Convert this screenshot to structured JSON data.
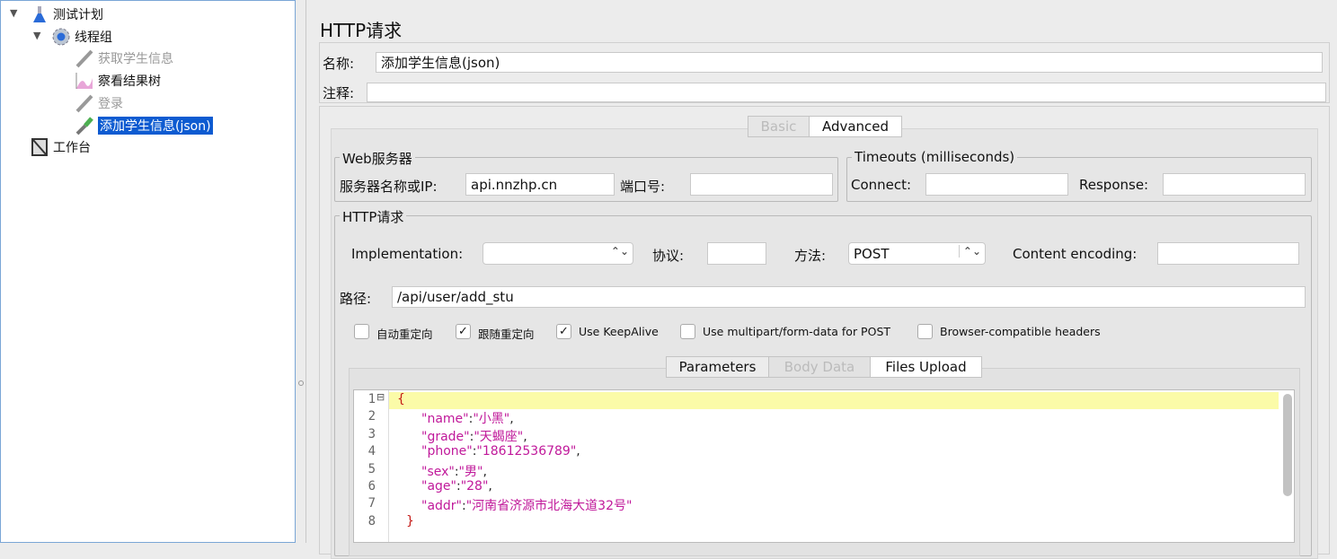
{
  "tree": {
    "items": [
      {
        "label": "测试计划",
        "icon": "test-plan-flask-icon",
        "state": "normal"
      },
      {
        "label": "线程组",
        "icon": "thread-group-gear-icon",
        "state": "normal"
      },
      {
        "label": "获取学生信息",
        "icon": "sampler-pipette-icon",
        "state": "disabled"
      },
      {
        "label": "察看结果树",
        "icon": "results-tree-chart-icon",
        "state": "normal"
      },
      {
        "label": "登录",
        "icon": "sampler-pipette-icon",
        "state": "disabled"
      },
      {
        "label": "添加学生信息(json)",
        "icon": "sampler-pipette-icon",
        "state": "selected"
      },
      {
        "label": "工作台",
        "icon": "workbench-icon",
        "state": "normal"
      }
    ]
  },
  "panel": {
    "title": "HTTP请求",
    "name_label": "名称:",
    "name_value": "添加学生信息(json)",
    "comment_label": "注释:",
    "comment_value": "",
    "tabs": [
      {
        "label": "Basic",
        "state": "disabled"
      },
      {
        "label": "Advanced",
        "state": "selected"
      }
    ],
    "web_server": {
      "legend": "Web服务器",
      "server_label": "服务器名称或IP:",
      "server_value": "api.nnzhp.cn",
      "port_label": "端口号:",
      "port_value": ""
    },
    "timeouts": {
      "legend": "Timeouts (milliseconds)",
      "connect_label": "Connect:",
      "connect_value": "",
      "response_label": "Response:",
      "response_value": ""
    },
    "http": {
      "legend": "HTTP请求",
      "impl_label": "Implementation:",
      "impl_value": "",
      "protocol_label": "协议:",
      "protocol_value": "",
      "method_label": "方法:",
      "method_value": "POST",
      "encoding_label": "Content encoding:",
      "encoding_value": "",
      "path_label": "路径:",
      "path_value": "/api/user/add_stu"
    },
    "checkboxes": [
      {
        "label": "自动重定向",
        "checked": false
      },
      {
        "label": "跟随重定向",
        "checked": true
      },
      {
        "label": "Use KeepAlive",
        "checked": true
      },
      {
        "label": "Use multipart/form-data for POST",
        "checked": false
      },
      {
        "label": "Browser-compatible headers",
        "checked": false
      }
    ],
    "subtabs": [
      {
        "label": "Parameters",
        "state": "normal"
      },
      {
        "label": "Body Data",
        "state": "disabled"
      },
      {
        "label": "Files Upload",
        "state": "normal"
      }
    ],
    "body_lines": [
      {
        "n": "1",
        "k": "",
        "v": "",
        "text": "{"
      },
      {
        "n": "2",
        "k": "\"name\"",
        "v": "\"小黑\"",
        "tail": ","
      },
      {
        "n": "3",
        "k": "\"grade\"",
        "v": "\"天蝎座\"",
        "tail": ","
      },
      {
        "n": "4",
        "k": "\"phone\"",
        "v": "\"18612536789\"",
        "tail": ","
      },
      {
        "n": "5",
        "k": "\"sex\"",
        "v": "\"男\"",
        "tail": ","
      },
      {
        "n": "6",
        "k": "\"age\"",
        "v": "\"28\"",
        "tail": ","
      },
      {
        "n": "7",
        "k": "\"addr\"",
        "v": "\"河南省济源市北海大道32号\"",
        "tail": ""
      },
      {
        "n": "8",
        "k": "",
        "v": "",
        "text": "}"
      }
    ],
    "highlight_color": "#fbfba8"
  }
}
